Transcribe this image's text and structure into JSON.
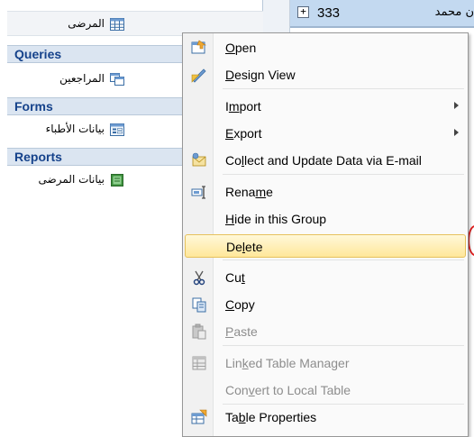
{
  "nav": {
    "tables_item": {
      "label": "المرضى"
    },
    "groups": [
      {
        "label": "Queries",
        "item": "المراجعين"
      },
      {
        "label": "Forms",
        "item": "بيانات الأطباء"
      },
      {
        "label": "Reports",
        "item": "بيانات المرضى"
      }
    ]
  },
  "table_row": {
    "expand": "+",
    "id": "333",
    "name": "ن محمد"
  },
  "menu": {
    "open": {
      "pre": "",
      "ul": "O",
      "post": "pen"
    },
    "design_view": {
      "pre": "",
      "ul": "D",
      "post": "esign View"
    },
    "import": {
      "pre": "I",
      "ul": "m",
      "post": "port"
    },
    "export": {
      "pre": "",
      "ul": "E",
      "post": "xport"
    },
    "collect": {
      "pre": "Co",
      "ul": "l",
      "post": "lect and Update Data via E-mail"
    },
    "rename": {
      "pre": "Rena",
      "ul": "m",
      "post": "e"
    },
    "hide": {
      "pre": "",
      "ul": "H",
      "post": "ide in this Group"
    },
    "delete": {
      "pre": "De",
      "ul": "l",
      "post": "ete"
    },
    "cut": {
      "pre": "Cu",
      "ul": "t",
      "post": ""
    },
    "copy": {
      "pre": "",
      "ul": "C",
      "post": "opy"
    },
    "paste": {
      "pre": "",
      "ul": "P",
      "post": "aste"
    },
    "linked": {
      "pre": "Lin",
      "ul": "k",
      "post": "ed Table Manager"
    },
    "convert": {
      "pre": "Con",
      "ul": "v",
      "post": "ert to Local Table"
    },
    "properties": {
      "pre": "Ta",
      "ul": "b",
      "post": "le Properties"
    }
  },
  "colors": {
    "accent": "#15428b",
    "highlight": "#ffe79a",
    "group_bg": "#dbe5f1"
  }
}
